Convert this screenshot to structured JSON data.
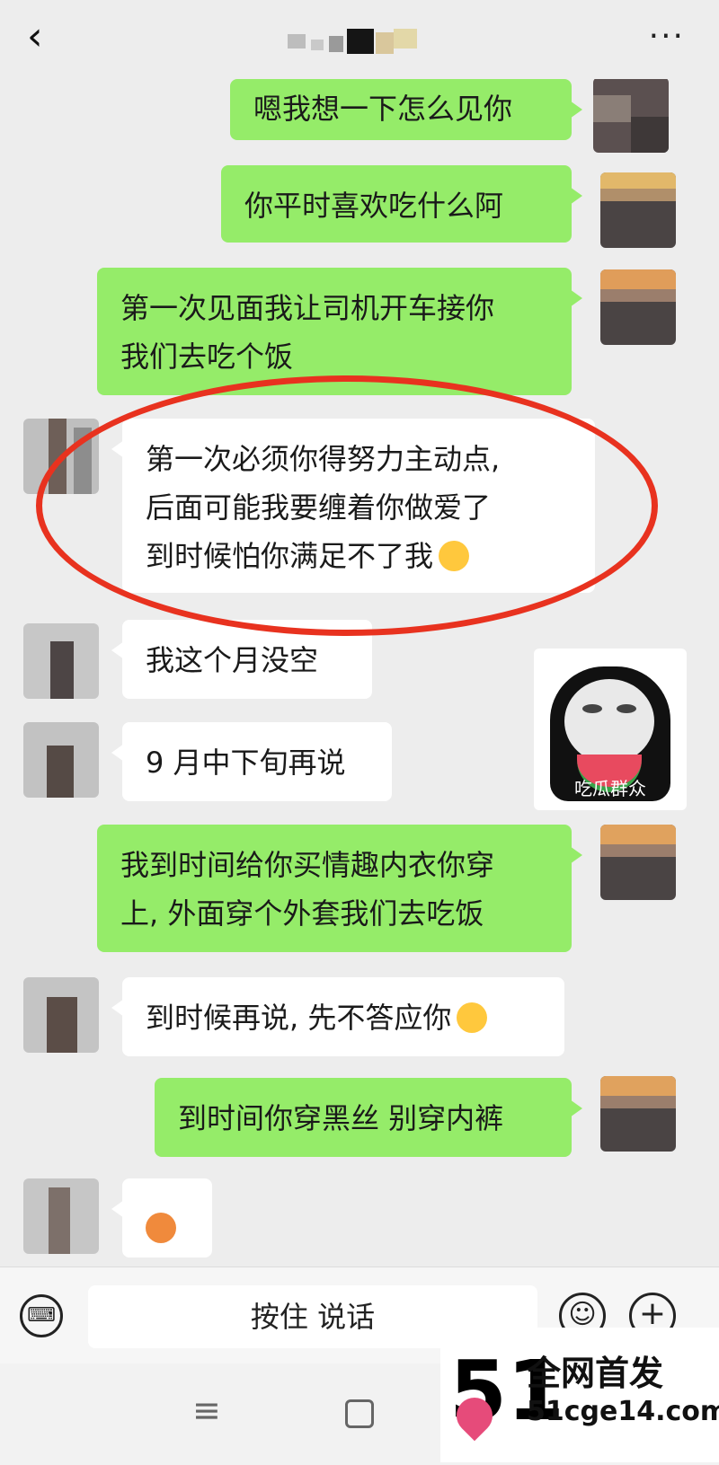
{
  "header": {
    "back_icon": "chevron-left-icon",
    "more_label": "···"
  },
  "messages": [
    {
      "side": "me",
      "lines": [
        "嗯我想一下怎么见你"
      ]
    },
    {
      "side": "me",
      "lines": [
        "你平时喜欢吃什么阿"
      ]
    },
    {
      "side": "me",
      "lines": [
        "第一次见面我让司机开车接你",
        "我们去吃个饭"
      ]
    },
    {
      "side": "other",
      "lines": [
        "第一次必须你得努力主动点,",
        "后面可能我要缠着你做爱了",
        "到时候怕你满足不了我"
      ],
      "emoji": "joy-emoji"
    },
    {
      "side": "other",
      "lines": [
        "我这个月没空"
      ]
    },
    {
      "side": "other",
      "lines": [
        "9 月中下旬再说"
      ]
    },
    {
      "side": "me",
      "lines": [
        "我到时间给你买情趣内衣你穿",
        "上, 外面穿个外套我们去吃饭"
      ]
    },
    {
      "side": "other",
      "lines": [
        "到时候再说, 先不答应你"
      ],
      "emoji": "wink-tongue-emoji"
    },
    {
      "side": "me",
      "lines": [
        "到时间你穿黑丝 别穿内裤"
      ]
    }
  ],
  "sticker": {
    "caption": "吃瓜群众"
  },
  "input_bar": {
    "hold_to_talk": "按住 说话",
    "keyboard_icon": "keyboard-icon",
    "emoji_icon": "smile-icon",
    "plus_icon": "plus-icon"
  },
  "nav": {
    "menu_icon": "menu-icon",
    "home_icon": "home-square-icon"
  },
  "watermark": {
    "logo": "51",
    "line1": "全网首发",
    "line2": "51cge14.com"
  },
  "colors": {
    "my_bubble": "#95ec69",
    "other_bubble": "#ffffff",
    "background": "#ededed",
    "annotation_circle": "#e8321f"
  }
}
